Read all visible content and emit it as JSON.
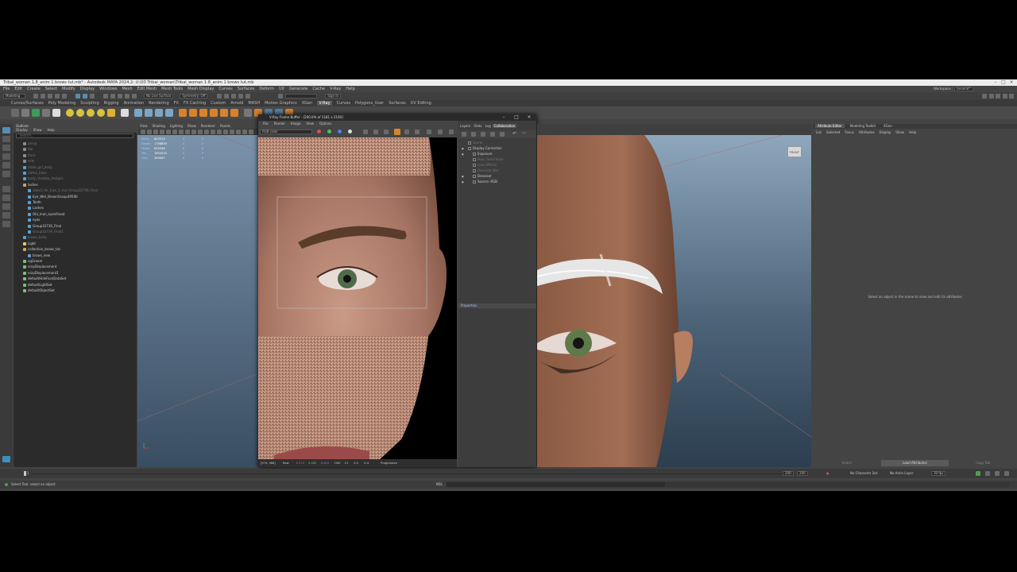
{
  "window": {
    "title": "Tribal_woman 1.8_anim 1 brows tut.mb* - Autodesk MAYA 2024.2: U:\\03 Tribal_woman\\Tribal_woman 1.8_anim 1 brows tut.mb",
    "workspace_label": "Workspace :",
    "workspace_value": "General*"
  },
  "menubar": [
    "File",
    "Edit",
    "Create",
    "Select",
    "Modify",
    "Display",
    "Windows",
    "Mesh",
    "Edit Mesh",
    "Mesh Tools",
    "Mesh Display",
    "Curves",
    "Surfaces",
    "Deform",
    "UV",
    "Generate",
    "Cache",
    "V-Ray",
    "Help"
  ],
  "statusline": {
    "mode": "Modeling",
    "live_surface": "No Live Surface",
    "symmetry": "Symmetry: Off",
    "sign_in": "Sign In"
  },
  "shelf_tabs": [
    {
      "label": "Curves/Surfaces",
      "active": false
    },
    {
      "label": "Poly Modeling",
      "active": false
    },
    {
      "label": "Sculpting",
      "active": false
    },
    {
      "label": "Rigging",
      "active": false
    },
    {
      "label": "Animation",
      "active": false
    },
    {
      "label": "Rendering",
      "active": false
    },
    {
      "label": "FX",
      "active": false
    },
    {
      "label": "FX Caching",
      "active": false
    },
    {
      "label": "Custom",
      "active": false
    },
    {
      "label": "Arnold",
      "active": false
    },
    {
      "label": "MASH",
      "active": false
    },
    {
      "label": "Motion Graphics",
      "active": false
    },
    {
      "label": "XGen",
      "active": false
    },
    {
      "label": "V-Ray",
      "active": true
    },
    {
      "label": "Curves",
      "active": false
    },
    {
      "label": "Polygons_User",
      "active": false
    },
    {
      "label": "Surfaces",
      "active": false
    },
    {
      "label": "UV Editing",
      "active": false
    }
  ],
  "outliner": {
    "title": "Outliner",
    "menu": [
      "Display",
      "Show",
      "Help"
    ],
    "search_placeholder": "Search...",
    "items": [
      {
        "label": "persp",
        "depth": 1,
        "dim": true,
        "icon": "camera-icon"
      },
      {
        "label": "top",
        "depth": 1,
        "dim": true,
        "icon": "camera-icon"
      },
      {
        "label": "front",
        "depth": 1,
        "dim": true,
        "icon": "camera-icon"
      },
      {
        "label": "side",
        "depth": 1,
        "dim": true,
        "icon": "camera-icon"
      },
      {
        "label": "tribal_girl_body",
        "depth": 1,
        "dim": true,
        "icon": "mesh-icon"
      },
      {
        "label": "tattoo_base",
        "depth": 1,
        "dim": true,
        "icon": "mesh-icon"
      },
      {
        "label": "body_shadow_designs",
        "depth": 1,
        "dim": true,
        "icon": "mesh-icon"
      },
      {
        "label": "lashes",
        "depth": 1,
        "dim": false,
        "icon": "group-icon"
      },
      {
        "label": "object_for_fuzz_2_eye_Group32739_Final",
        "depth": 2,
        "dim": true,
        "icon": "mesh-icon"
      },
      {
        "label": "Eye_Wet_BrownGroup49590",
        "depth": 2,
        "dim": false,
        "icon": "mesh-icon"
      },
      {
        "label": "Teeth",
        "depth": 2,
        "dim": false,
        "icon": "mesh-icon"
      },
      {
        "label": "Lashes",
        "depth": 2,
        "dim": false,
        "icon": "mesh-icon"
      },
      {
        "label": "Old_man_eyes/head",
        "depth": 2,
        "dim": false,
        "icon": "mesh-icon"
      },
      {
        "label": "eyes",
        "depth": 2,
        "dim": false,
        "icon": "mesh-icon"
      },
      {
        "label": "Group32739_Final",
        "depth": 2,
        "dim": false,
        "icon": "mesh-icon"
      },
      {
        "label": "Group32739_Final1",
        "depth": 2,
        "dim": true,
        "icon": "mesh-icon"
      },
      {
        "label": "brows_body",
        "depth": 1,
        "dim": true,
        "icon": "mesh-icon"
      },
      {
        "label": "Light",
        "depth": 1,
        "dim": false,
        "icon": "light-icon"
      },
      {
        "label": "collection_brows_tut",
        "depth": 1,
        "dim": false,
        "icon": "group-icon"
      },
      {
        "label": "brows_new",
        "depth": 2,
        "dim": false,
        "icon": "mesh-icon"
      },
      {
        "label": "vgGroom",
        "depth": 1,
        "dim": false,
        "icon": "set-icon"
      },
      {
        "label": "vrayDisplacement",
        "depth": 1,
        "dim": false,
        "icon": "set-icon"
      },
      {
        "label": "vrayDisplacement1",
        "depth": 1,
        "dim": false,
        "icon": "set-icon"
      },
      {
        "label": "defaultHideFaceDataSet",
        "depth": 1,
        "dim": false,
        "icon": "set-icon"
      },
      {
        "label": "defaultLightSet",
        "depth": 1,
        "dim": false,
        "icon": "set-icon"
      },
      {
        "label": "defaultObjectSet",
        "depth": 1,
        "dim": false,
        "icon": "set-icon"
      }
    ]
  },
  "viewport_left": {
    "menu": [
      "View",
      "Shading",
      "Lighting",
      "Show",
      "Renderer",
      "Panels"
    ],
    "hud": [
      {
        "label": "Verts:",
        "v1": "803374",
        "v2": "0",
        "v3": "0"
      },
      {
        "label": "Edges:",
        "v1": "1758850",
        "v2": "0",
        "v3": "0"
      },
      {
        "label": "Faces:",
        "v1": "845946",
        "v2": "0",
        "v3": "0"
      },
      {
        "label": "Tris:",
        "v1": "1652033",
        "v2": "0",
        "v3": "0"
      },
      {
        "label": "UVs:",
        "v1": "263467",
        "v2": "0",
        "v3": "0"
      }
    ]
  },
  "vfb": {
    "title": "V-Ray Frame Buffer - [200.0% of 1181 x 2100]",
    "menu": [
      "File",
      "Render",
      "Image",
      "View",
      "Options"
    ],
    "channel": "RGB color",
    "status": {
      "coords": "[974, 966]",
      "mode": "Raw",
      "r": "0.374",
      "g": "0.282",
      "b": "0.224",
      "space": "HSV",
      "h": "21",
      "s": "0.2",
      "v": "0.4",
      "tail": "Progressive"
    },
    "panel_tabs": [
      {
        "label": "Layers",
        "active": false
      },
      {
        "label": "Stats",
        "active": false
      },
      {
        "label": "Log",
        "active": false
      },
      {
        "label": "Collaboration",
        "active": true
      }
    ],
    "layers": [
      {
        "label": "Scene",
        "depth": 0,
        "dim": true,
        "eye": false
      },
      {
        "label": "Display Correction",
        "depth": 0,
        "dim": false,
        "eye": true
      },
      {
        "label": "Exposure",
        "depth": 1,
        "dim": false,
        "eye": true
      },
      {
        "label": "Hue / Saturation",
        "depth": 1,
        "dim": true,
        "eye": false
      },
      {
        "label": "Lens Effects",
        "depth": 1,
        "dim": true,
        "eye": false
      },
      {
        "label": "Denoiser Blur",
        "depth": 1,
        "dim": true,
        "eye": false
      },
      {
        "label": "Denoiser",
        "depth": 1,
        "dim": false,
        "eye": true
      },
      {
        "label": "Source: RGB",
        "depth": 1,
        "dim": false,
        "eye": true
      }
    ],
    "properties_label": "Properties"
  },
  "viewport_right": {
    "viewcube": "FRONT"
  },
  "attribute_editor": {
    "tabs": [
      {
        "label": "Attribute Editor",
        "active": true
      },
      {
        "label": "Modeling Toolkit",
        "active": false
      },
      {
        "label": "XGen",
        "active": false
      }
    ],
    "menu": [
      "List",
      "Selected",
      "Focus",
      "Attributes",
      "Display",
      "Show",
      "Help"
    ],
    "message": "Select an object in the scene to view and edit its attributes",
    "buttons": [
      "Select",
      "Load Attributes",
      "Copy Tab"
    ]
  },
  "timeslider": {
    "range_start": "1",
    "start_field": "1",
    "end_field": "200",
    "end_field2": "200",
    "character_set": "No Character Set",
    "anim_layer": "No Anim Layer",
    "fps": "30 fps"
  },
  "helpline": {
    "message": "Select Tool: select an object",
    "command_label": "MEL"
  },
  "colors": {
    "accent_blue": "#5a8bb0",
    "shelf_orange": "#d9822b",
    "shelf_yellow": "#d8c43c"
  }
}
